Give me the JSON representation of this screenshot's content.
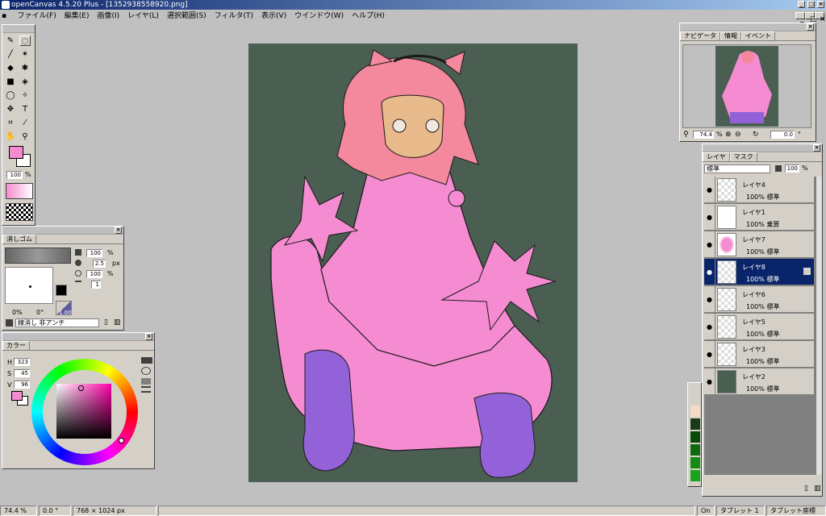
{
  "window": {
    "title": "openCanvas 4.5.20 Plus - [1352938558920.png]"
  },
  "menu": [
    "ファイル(F)",
    "編集(E)",
    "画像(I)",
    "レイヤ(L)",
    "選択範囲(S)",
    "フィルタ(T)",
    "表示(V)",
    "ウインドウ(W)",
    "ヘルプ(H)"
  ],
  "toolbox": {
    "opacity": "100",
    "opacity_unit": "%"
  },
  "eraser_panel": {
    "tab": "消しゴム",
    "opacity": "100",
    "size": "2.5",
    "size_unit": "px",
    "density": "100",
    "spacing": "1",
    "pct_label": "%",
    "angle_left": "0%",
    "angle_mid": "0°",
    "ratio": "1.00",
    "preset": "線消し 非アンチ"
  },
  "color_panel": {
    "tab": "カラー",
    "h_label": "H",
    "h": "323",
    "s_label": "S",
    "s": "45",
    "v_label": "V",
    "v": "96",
    "current_color": "#f58bd1"
  },
  "navigator": {
    "tabs": [
      "ナビゲータ",
      "情報",
      "イベント"
    ],
    "zoom": "74.4",
    "zoom_unit": "%",
    "angle": "0.0",
    "angle_unit": "°"
  },
  "layers_panel": {
    "tabs": [
      "レイヤ",
      "マスク"
    ],
    "blend": "標準",
    "opacity": "100",
    "opacity_unit": "%",
    "layers": [
      {
        "name": "レイヤ4",
        "mode": "100% 標準",
        "selected": false
      },
      {
        "name": "レイヤ1",
        "mode": "100% 乗算",
        "selected": false
      },
      {
        "name": "レイヤ7",
        "mode": "100% 標準",
        "selected": false
      },
      {
        "name": "レイヤ8",
        "mode": "100% 標準",
        "selected": true
      },
      {
        "name": "レイヤ6",
        "mode": "100% 標準",
        "selected": false
      },
      {
        "name": "レイヤ5",
        "mode": "100% 標準",
        "selected": false
      },
      {
        "name": "レイヤ3",
        "mode": "100% 標準",
        "selected": false
      },
      {
        "name": "レイヤ2",
        "mode": "100% 標準",
        "selected": false
      }
    ]
  },
  "status": {
    "zoom": "74.4 %",
    "angle": "0.0 °",
    "size": "768 × 1024 px",
    "on": "On",
    "tablet": "タブレット 1",
    "tablet_coords": "タブレット座標"
  },
  "colors": {
    "canvas_bg": "#4a5e52",
    "pink": "#f58bd1",
    "purple": "#9462d8",
    "hair": "#f4889c",
    "skin": "#e8b98a",
    "title_bar": "#0a246a"
  }
}
